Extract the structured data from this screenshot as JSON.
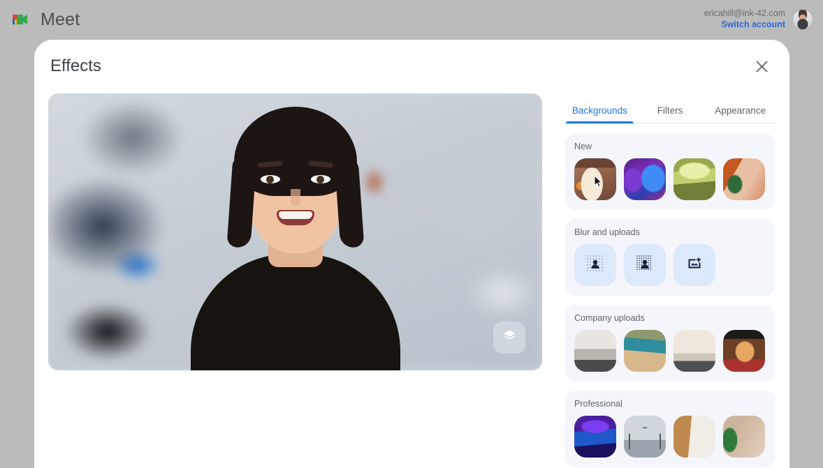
{
  "topbar": {
    "brand_name": "Meet",
    "logo_icon": "google-meet-logo",
    "account_email": "ericahill@ink-42.com",
    "switch_account_label": "Switch account",
    "avatar_icon": "user-avatar"
  },
  "dialog": {
    "title": "Effects",
    "close_icon": "close-icon"
  },
  "preview": {
    "effects_fab_icon": "layers-effects-icon"
  },
  "panel": {
    "tabs": [
      {
        "label": "Backgrounds",
        "active": true
      },
      {
        "label": "Filters",
        "active": false
      },
      {
        "label": "Appearance",
        "active": false
      }
    ],
    "sections": [
      {
        "title": "New",
        "type": "thumbnails",
        "items": [
          {
            "name": "new-background-1",
            "art": "t-new1",
            "cursor": true
          },
          {
            "name": "new-background-2",
            "art": "t-new2",
            "cursor": false
          },
          {
            "name": "new-background-3",
            "art": "t-new3",
            "cursor": false
          },
          {
            "name": "new-background-4",
            "art": "t-new4",
            "cursor": false
          }
        ]
      },
      {
        "title": "Blur and uploads",
        "type": "buttons",
        "items": [
          {
            "name": "slight-blur-button",
            "icon": "slight-blur-icon"
          },
          {
            "name": "heavy-blur-button",
            "icon": "heavy-blur-icon"
          },
          {
            "name": "upload-image-button",
            "icon": "add-image-icon"
          }
        ]
      },
      {
        "title": "Company uploads",
        "type": "thumbnails",
        "items": [
          {
            "name": "company-background-1",
            "art": "t-co1",
            "cursor": false
          },
          {
            "name": "company-background-2",
            "art": "t-co2",
            "cursor": false
          },
          {
            "name": "company-background-3",
            "art": "t-co3",
            "cursor": false
          },
          {
            "name": "company-background-4",
            "art": "t-co4",
            "cursor": false
          }
        ]
      },
      {
        "title": "Professional",
        "type": "thumbnails",
        "items": [
          {
            "name": "professional-background-1",
            "art": "t-pr1",
            "cursor": false
          },
          {
            "name": "professional-background-2",
            "art": "t-pr2",
            "cursor": false
          },
          {
            "name": "professional-background-3",
            "art": "t-pr3",
            "cursor": false
          },
          {
            "name": "professional-background-4",
            "art": "t-pr4",
            "cursor": false
          }
        ]
      }
    ]
  },
  "colors": {
    "page_background": "#bbbbbb",
    "dialog_background": "#ffffff",
    "accent_blue": "#1a73e8",
    "link_blue": "#2f6ad1",
    "section_background": "#f4f6fb",
    "blur_button_background": "#dce9fb",
    "text_primary": "#3c4043",
    "text_secondary": "#5f6368"
  }
}
